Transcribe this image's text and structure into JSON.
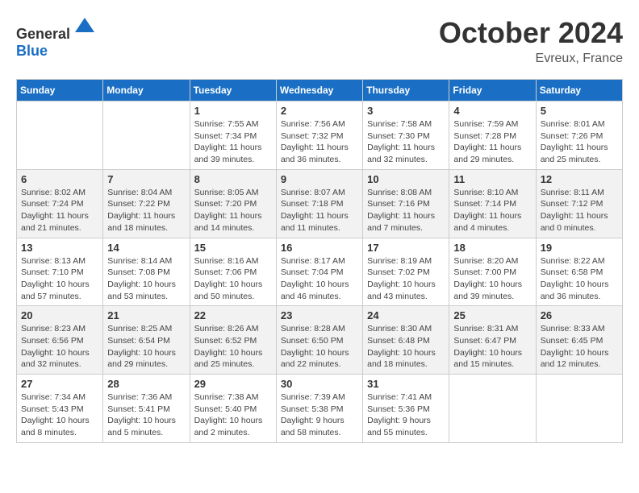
{
  "header": {
    "logo_general": "General",
    "logo_blue": "Blue",
    "month_title": "October 2024",
    "location": "Evreux, France"
  },
  "weekdays": [
    "Sunday",
    "Monday",
    "Tuesday",
    "Wednesday",
    "Thursday",
    "Friday",
    "Saturday"
  ],
  "weeks": [
    [
      {
        "day": "",
        "info": ""
      },
      {
        "day": "",
        "info": ""
      },
      {
        "day": "1",
        "info": "Sunrise: 7:55 AM\nSunset: 7:34 PM\nDaylight: 11 hours and 39 minutes."
      },
      {
        "day": "2",
        "info": "Sunrise: 7:56 AM\nSunset: 7:32 PM\nDaylight: 11 hours and 36 minutes."
      },
      {
        "day": "3",
        "info": "Sunrise: 7:58 AM\nSunset: 7:30 PM\nDaylight: 11 hours and 32 minutes."
      },
      {
        "day": "4",
        "info": "Sunrise: 7:59 AM\nSunset: 7:28 PM\nDaylight: 11 hours and 29 minutes."
      },
      {
        "day": "5",
        "info": "Sunrise: 8:01 AM\nSunset: 7:26 PM\nDaylight: 11 hours and 25 minutes."
      }
    ],
    [
      {
        "day": "6",
        "info": "Sunrise: 8:02 AM\nSunset: 7:24 PM\nDaylight: 11 hours and 21 minutes."
      },
      {
        "day": "7",
        "info": "Sunrise: 8:04 AM\nSunset: 7:22 PM\nDaylight: 11 hours and 18 minutes."
      },
      {
        "day": "8",
        "info": "Sunrise: 8:05 AM\nSunset: 7:20 PM\nDaylight: 11 hours and 14 minutes."
      },
      {
        "day": "9",
        "info": "Sunrise: 8:07 AM\nSunset: 7:18 PM\nDaylight: 11 hours and 11 minutes."
      },
      {
        "day": "10",
        "info": "Sunrise: 8:08 AM\nSunset: 7:16 PM\nDaylight: 11 hours and 7 minutes."
      },
      {
        "day": "11",
        "info": "Sunrise: 8:10 AM\nSunset: 7:14 PM\nDaylight: 11 hours and 4 minutes."
      },
      {
        "day": "12",
        "info": "Sunrise: 8:11 AM\nSunset: 7:12 PM\nDaylight: 11 hours and 0 minutes."
      }
    ],
    [
      {
        "day": "13",
        "info": "Sunrise: 8:13 AM\nSunset: 7:10 PM\nDaylight: 10 hours and 57 minutes."
      },
      {
        "day": "14",
        "info": "Sunrise: 8:14 AM\nSunset: 7:08 PM\nDaylight: 10 hours and 53 minutes."
      },
      {
        "day": "15",
        "info": "Sunrise: 8:16 AM\nSunset: 7:06 PM\nDaylight: 10 hours and 50 minutes."
      },
      {
        "day": "16",
        "info": "Sunrise: 8:17 AM\nSunset: 7:04 PM\nDaylight: 10 hours and 46 minutes."
      },
      {
        "day": "17",
        "info": "Sunrise: 8:19 AM\nSunset: 7:02 PM\nDaylight: 10 hours and 43 minutes."
      },
      {
        "day": "18",
        "info": "Sunrise: 8:20 AM\nSunset: 7:00 PM\nDaylight: 10 hours and 39 minutes."
      },
      {
        "day": "19",
        "info": "Sunrise: 8:22 AM\nSunset: 6:58 PM\nDaylight: 10 hours and 36 minutes."
      }
    ],
    [
      {
        "day": "20",
        "info": "Sunrise: 8:23 AM\nSunset: 6:56 PM\nDaylight: 10 hours and 32 minutes."
      },
      {
        "day": "21",
        "info": "Sunrise: 8:25 AM\nSunset: 6:54 PM\nDaylight: 10 hours and 29 minutes."
      },
      {
        "day": "22",
        "info": "Sunrise: 8:26 AM\nSunset: 6:52 PM\nDaylight: 10 hours and 25 minutes."
      },
      {
        "day": "23",
        "info": "Sunrise: 8:28 AM\nSunset: 6:50 PM\nDaylight: 10 hours and 22 minutes."
      },
      {
        "day": "24",
        "info": "Sunrise: 8:30 AM\nSunset: 6:48 PM\nDaylight: 10 hours and 18 minutes."
      },
      {
        "day": "25",
        "info": "Sunrise: 8:31 AM\nSunset: 6:47 PM\nDaylight: 10 hours and 15 minutes."
      },
      {
        "day": "26",
        "info": "Sunrise: 8:33 AM\nSunset: 6:45 PM\nDaylight: 10 hours and 12 minutes."
      }
    ],
    [
      {
        "day": "27",
        "info": "Sunrise: 7:34 AM\nSunset: 5:43 PM\nDaylight: 10 hours and 8 minutes."
      },
      {
        "day": "28",
        "info": "Sunrise: 7:36 AM\nSunset: 5:41 PM\nDaylight: 10 hours and 5 minutes."
      },
      {
        "day": "29",
        "info": "Sunrise: 7:38 AM\nSunset: 5:40 PM\nDaylight: 10 hours and 2 minutes."
      },
      {
        "day": "30",
        "info": "Sunrise: 7:39 AM\nSunset: 5:38 PM\nDaylight: 9 hours and 58 minutes."
      },
      {
        "day": "31",
        "info": "Sunrise: 7:41 AM\nSunset: 5:36 PM\nDaylight: 9 hours and 55 minutes."
      },
      {
        "day": "",
        "info": ""
      },
      {
        "day": "",
        "info": ""
      }
    ]
  ]
}
